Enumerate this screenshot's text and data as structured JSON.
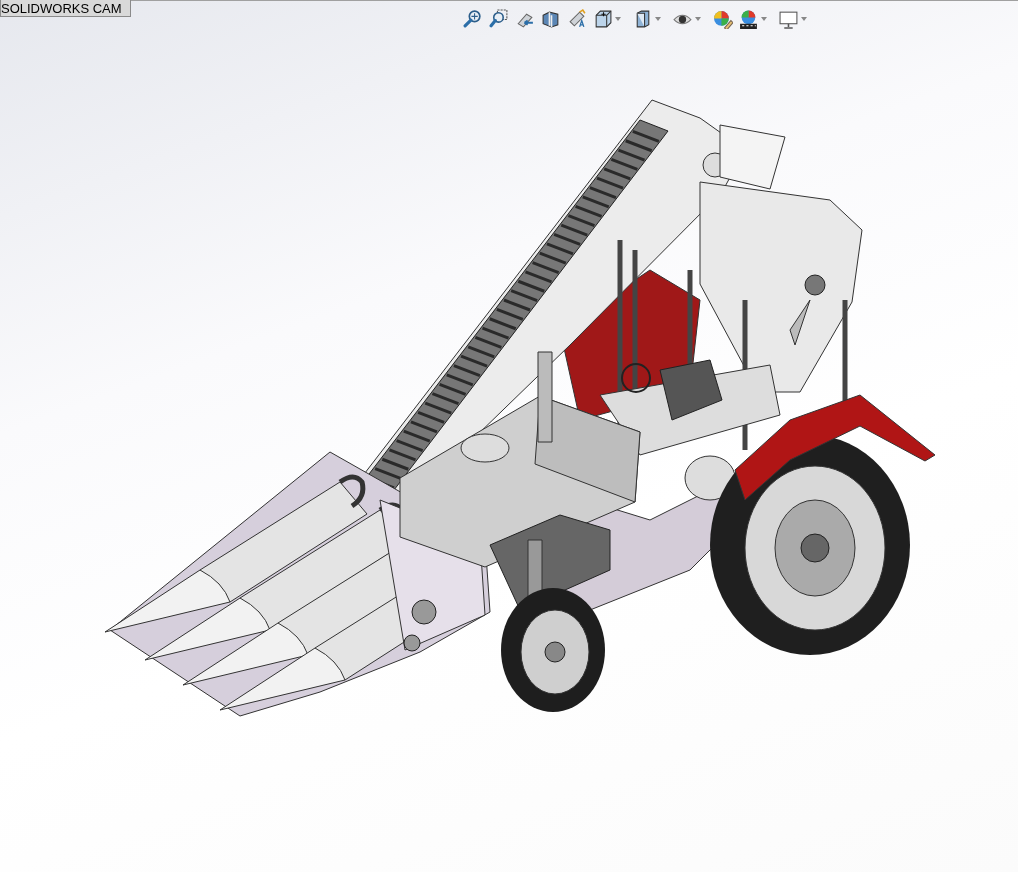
{
  "command_tabs": [
    {
      "label": "SOLIDWORKS CAM",
      "selected": false
    }
  ],
  "view_toolbar": [
    {
      "kind": "zoom-fit",
      "dropdown": false
    },
    {
      "kind": "zoom-area",
      "dropdown": false
    },
    {
      "kind": "previous-view",
      "dropdown": false
    },
    {
      "kind": "section-view",
      "dropdown": false
    },
    {
      "kind": "annotation-view",
      "dropdown": false
    },
    {
      "kind": "view-orientation",
      "dropdown": true
    },
    {
      "kind": "display-style",
      "dropdown": true
    },
    {
      "kind": "hide-show",
      "dropdown": true
    },
    {
      "kind": "appearance",
      "dropdown": false
    },
    {
      "kind": "scenes",
      "dropdown": true
    },
    {
      "kind": "view-settings",
      "dropdown": true
    }
  ]
}
